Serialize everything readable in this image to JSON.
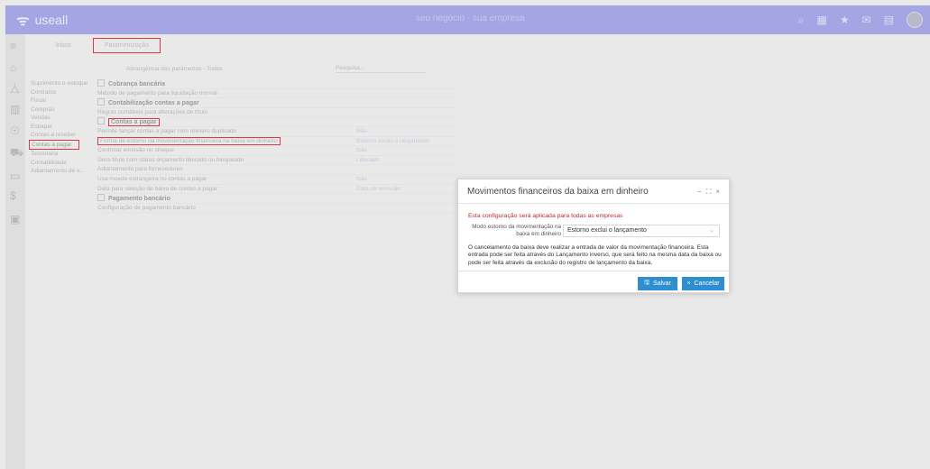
{
  "app": {
    "logo_text": "useall",
    "company": "seu negócio · sua empresa",
    "search_placeholder": "Pesquisar"
  },
  "tabs": {
    "home": "Início",
    "active": "Parametrização"
  },
  "filter": {
    "abrangencia": "Abrangência dos parâmetros - Todos",
    "search_placeholder": "Pesquisa..."
  },
  "menu": {
    "items": [
      {
        "label": "Suprimento e estoque"
      },
      {
        "label": "Contratos"
      },
      {
        "label": "Fiscal"
      },
      {
        "label": "Compras"
      },
      {
        "label": "Vendas"
      },
      {
        "label": "Estoque"
      },
      {
        "label": "Contas a receber"
      },
      {
        "label": "Contas a pagar"
      },
      {
        "label": "Tesouraria"
      },
      {
        "label": "Contabilidade"
      },
      {
        "label": "Adiantamento de v..."
      }
    ]
  },
  "params": {
    "rows": [
      {
        "label": "Cobrança bancária",
        "value": ""
      },
      {
        "label": "Método de pagamento para liquidação normal",
        "value": ""
      },
      {
        "label": "Contabilização contas a pagar",
        "value": ""
      },
      {
        "label": "Regras contábeis para alterações de título",
        "value": ""
      },
      {
        "label": "Contas a pagar",
        "value": ""
      },
      {
        "label": "Permite lançar contas a pagar com número duplicado",
        "value": "Não"
      },
      {
        "label": "Forma de estorno da movimentação financeira na baixa em dinheiro",
        "value": "Estorno exclui o lançamento"
      },
      {
        "label": "Controlar emissão no cheque",
        "value": "Não"
      },
      {
        "label": "Gera título com status orçamento liberado ou bloqueado",
        "value": "Liberado"
      },
      {
        "label": "Adiantamento para fornecedores",
        "value": ""
      },
      {
        "label": "Usa moeda estrangeira no contas a pagar",
        "value": "Não"
      },
      {
        "label": "Data para seleção de baixa de contas a pagar",
        "value": "Data de emissão"
      },
      {
        "label": "Pagamento bancário",
        "value": ""
      },
      {
        "label": "Configuração de pagamento bancário",
        "value": ""
      }
    ]
  },
  "modal": {
    "title": "Movimentos financeiros da baixa em dinheiro",
    "warning": "Esta configuração será aplicada para todas as empresas",
    "field_label": "Modo estorno da movimentação na baixa em dinheiro",
    "field_value": "Estorno exclui o lançamento",
    "description": "O cancelamento da baixa deve realizar a entrada de valor da movimentação financeira. Esta entrada pode ser feita através do Lançamento inverso, que será feito na mesma data da baixa ou pode ser feita através da exclusão do registro de lançamento da baixa.",
    "save_label": "Salvar",
    "cancel_label": "Cancelar"
  },
  "colors": {
    "accent": "#2d8fcf",
    "topbar": "#a5a5e3",
    "warning": "#c2272d",
    "highlight_border": "#d9394a"
  }
}
